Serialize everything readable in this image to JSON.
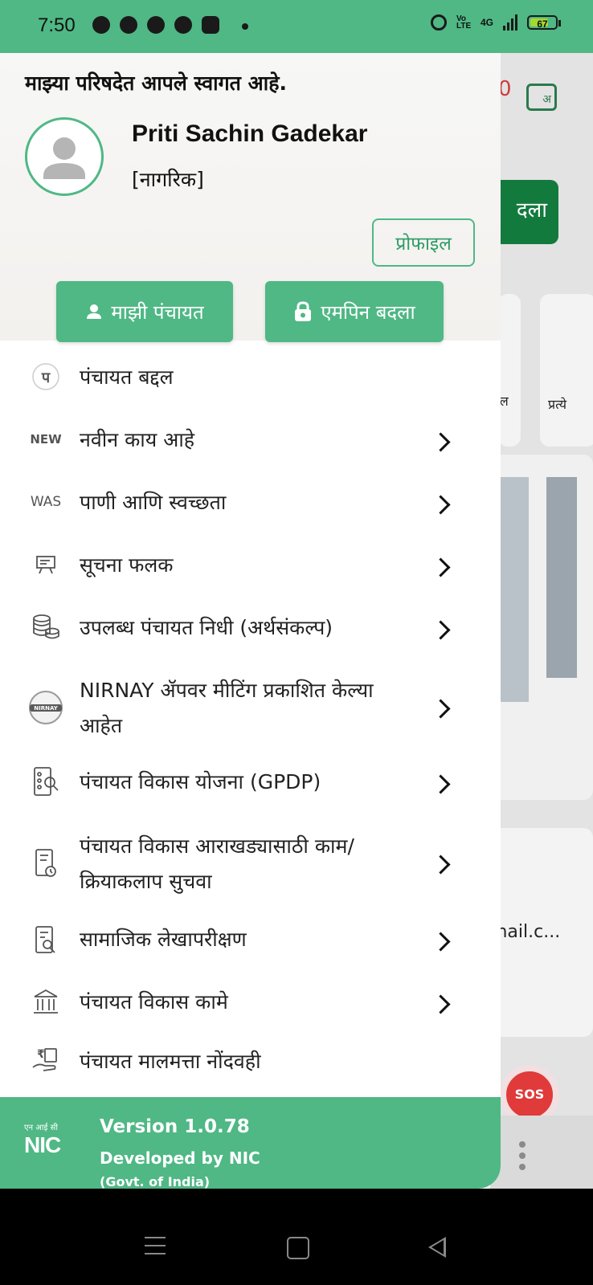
{
  "status_bar": {
    "time": "7:50",
    "apps": [
      "facebook-icon",
      "snapchat-icon",
      "messenger-icon",
      "whatsapp-icon",
      "instagram-icon"
    ],
    "network": "4G",
    "volte": "Vo LTE",
    "battery": "67"
  },
  "background": {
    "counter": "0",
    "lang_icon_text": "अ",
    "button_partial": "दला",
    "label_water": "जल",
    "label_partial": "प्रत्ये",
    "email_partial": "mail.c...",
    "sos": "SOS"
  },
  "drawer": {
    "welcome": "माझ्या परिषदेत आपले स्वागत आहे.",
    "user_name": "Priti Sachin Gadekar",
    "user_role": "[नागरिक]",
    "profile_button": "प्रोफाइल",
    "my_panchayat_button": "माझी पंचायत",
    "change_mpin_button": "एमपिन बदला",
    "menu": [
      {
        "icon": "panchayat-logo-icon",
        "icon_text": "पं",
        "label": "पंचायत बद्दल",
        "chevron": false
      },
      {
        "icon": "new-badge-icon",
        "icon_text": "NEW",
        "label": "नवीन काय आहे",
        "chevron": true
      },
      {
        "icon": "was-badge-icon",
        "icon_text": "WAS",
        "label": "पाणी आणि स्वच्छता",
        "chevron": true
      },
      {
        "icon": "notice-board-icon",
        "icon_text": "",
        "label": "सूचना फलक",
        "chevron": true
      },
      {
        "icon": "coins-icon",
        "icon_text": "",
        "label": "उपलब्ध पंचायत निधी (अर्थसंकल्प)",
        "chevron": true
      },
      {
        "icon": "nirnay-logo-icon",
        "icon_text": "NIRNAY",
        "label": "NIRNAY ॲपवर मीटिंग प्रकाशित केल्या आहेत",
        "chevron": true
      },
      {
        "icon": "plan-search-icon",
        "icon_text": "",
        "label": "पंचायत विकास योजना (GPDP)",
        "chevron": true
      },
      {
        "icon": "document-clock-icon",
        "icon_text": "",
        "label": "पंचायत विकास आराखड्यासाठी काम/क्रियाकलाप सुचवा",
        "chevron": true
      },
      {
        "icon": "audit-search-icon",
        "icon_text": "",
        "label": "सामाजिक लेखापरीक्षण",
        "chevron": true
      },
      {
        "icon": "building-icon",
        "icon_text": "",
        "label": "पंचायत विकास कामे",
        "chevron": true
      },
      {
        "icon": "asset-register-icon",
        "icon_text": "",
        "label": "पंचायत मालमत्ता नोंदवही",
        "chevron": false
      }
    ],
    "footer": {
      "logo_small": "एन आई सी",
      "logo_big": "NIC",
      "version": "Version 1.0.78",
      "developed_by": "Developed by NIC",
      "govt": "(Govt. of India)"
    }
  },
  "colors": {
    "brand_green": "#4fb885",
    "dark_green": "#137a3d",
    "sos_red": "#e03a3a"
  }
}
